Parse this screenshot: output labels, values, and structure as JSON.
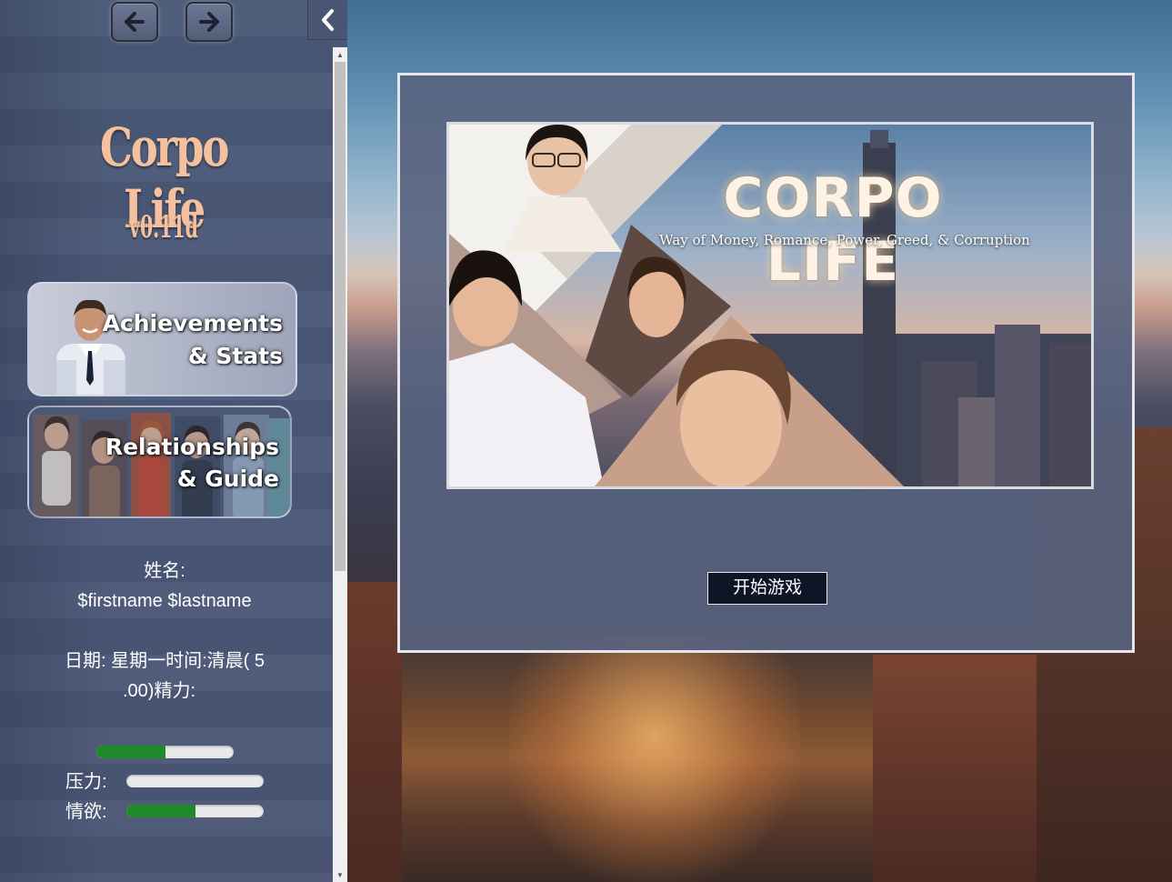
{
  "nav": {
    "back_icon": "arrow-left-icon",
    "forward_icon": "arrow-right-icon",
    "collapse_icon": "chevron-left-icon"
  },
  "logo": {
    "title": "Corpo Life",
    "version": "v0.11d"
  },
  "menu": {
    "achievements_line1": "Achievements",
    "achievements_line2": "& Stats",
    "relationships_line1": "Relationships",
    "relationships_line2": "& Guide"
  },
  "stats": {
    "name_label": "姓名:",
    "name_value": "$firstname $lastname",
    "date_line1": "日期:  星期一时间:清晨( 5",
    "date_line2": ".00)精力:",
    "energy_level": 0.5,
    "stress_label": "压力:",
    "stress_level": 0.0,
    "lust_label": "情欲:",
    "lust_level": 0.5
  },
  "cover": {
    "title": "CORPO LIFE",
    "subtitle": "Way of Money, Romance, Power, Greed, &  Corruption"
  },
  "main": {
    "start_button": "开始游戏"
  },
  "colors": {
    "sidebar_bg": "#4a5878",
    "logo": "#f4c09e",
    "bar_fill": "#1f8a2a",
    "bar_track": "#e9e9e9",
    "button_bg": "#0e1526"
  }
}
